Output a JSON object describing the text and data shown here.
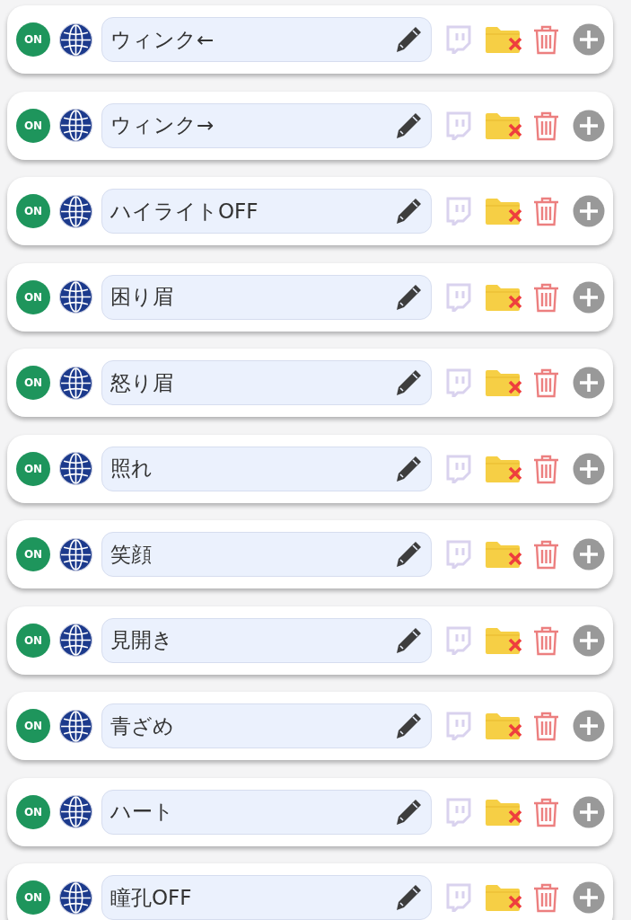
{
  "rows": [
    {
      "toggle": {
        "label": "ON",
        "on": true
      },
      "name": "ウィンク←"
    },
    {
      "toggle": {
        "label": "ON",
        "on": true
      },
      "name": "ウィンク→"
    },
    {
      "toggle": {
        "label": "ON",
        "on": true
      },
      "name": "ハイライトOFF"
    },
    {
      "toggle": {
        "label": "ON",
        "on": true
      },
      "name": "困り眉"
    },
    {
      "toggle": {
        "label": "ON",
        "on": true
      },
      "name": "怒り眉"
    },
    {
      "toggle": {
        "label": "ON",
        "on": true
      },
      "name": "照れ"
    },
    {
      "toggle": {
        "label": "ON",
        "on": true
      },
      "name": "笑顔"
    },
    {
      "toggle": {
        "label": "ON",
        "on": true
      },
      "name": "見開き"
    },
    {
      "toggle": {
        "label": "ON",
        "on": true
      },
      "name": "青ざめ"
    },
    {
      "toggle": {
        "label": "ON",
        "on": true
      },
      "name": "ハート"
    },
    {
      "toggle": {
        "label": "ON",
        "on": true
      },
      "name": "瞳孔OFF"
    }
  ]
}
